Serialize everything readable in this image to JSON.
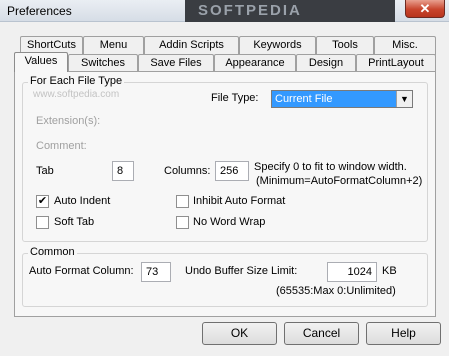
{
  "window": {
    "title": "Preferences",
    "watermark": "SOFTPEDIA",
    "close_glyph": "✕"
  },
  "tabs_back": [
    "ShortCuts",
    "Menu",
    "Addin Scripts",
    "Keywords",
    "Tools",
    "Misc."
  ],
  "tabs_front": [
    "Values",
    "Switches",
    "Save Files",
    "Appearance",
    "Design",
    "PrintLayout"
  ],
  "active_tab": "Values",
  "file_group": {
    "legend": "For Each File Type",
    "hint": "www.softpedia.com",
    "file_type_label": "File Type:",
    "file_type_value": "Current File",
    "extensions_label": "Extension(s):",
    "comment_label": "Comment:",
    "tab_label": "Tab",
    "tab_value": "8",
    "columns_label": "Columns:",
    "columns_value": "256",
    "columns_hint_1": "Specify 0 to fit to window width.",
    "columns_hint_2": "(Minimum=AutoFormatColumn+2)",
    "auto_indent": {
      "label": "Auto Indent",
      "checked": true
    },
    "inhibit_auto_format": {
      "label": "Inhibit Auto Format",
      "checked": false
    },
    "soft_tab": {
      "label": "Soft Tab",
      "checked": false
    },
    "no_word_wrap": {
      "label": "No Word Wrap",
      "checked": false
    }
  },
  "common_group": {
    "legend": "Common",
    "auto_format_label": "Auto Format Column:",
    "auto_format_value": "73",
    "undo_label": "Undo Buffer Size Limit:",
    "undo_value": "1024",
    "undo_unit": "KB",
    "undo_hint": "(65535:Max   0:Unlimited)"
  },
  "buttons": {
    "ok": "OK",
    "cancel": "Cancel",
    "help": "Help"
  },
  "check_glyph": "✔",
  "dropdown_glyph": "▼"
}
